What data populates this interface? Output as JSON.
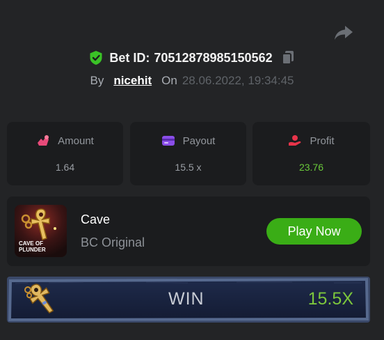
{
  "bet": {
    "id_label": "Bet ID:",
    "id_value": "70512878985150562",
    "by_label": "By",
    "username": "nicehit",
    "on_label": "On",
    "datetime": "28.06.2022, 19:34:45"
  },
  "stats": [
    {
      "label": "Amount",
      "value": "1.64",
      "icon": "amount-icon",
      "color": "#e84a7a"
    },
    {
      "label": "Payout",
      "value": "15.5 x",
      "icon": "payout-icon",
      "color": "#8a4ee8"
    },
    {
      "label": "Profit",
      "value": "23.76",
      "icon": "profit-icon",
      "color": "#e8344a"
    }
  ],
  "game": {
    "name": "Cave",
    "category": "BC Original",
    "thumbnail_text_1": "CAVE OF",
    "thumbnail_text_2": "PLUNDER",
    "play_label": "Play Now"
  },
  "result": {
    "label": "WIN",
    "multiplier": "15.5X"
  },
  "colors": {
    "background": "#232426",
    "card": "#1b1c1e",
    "accent_green": "#3aad16",
    "profit_green": "#6ac93a"
  }
}
